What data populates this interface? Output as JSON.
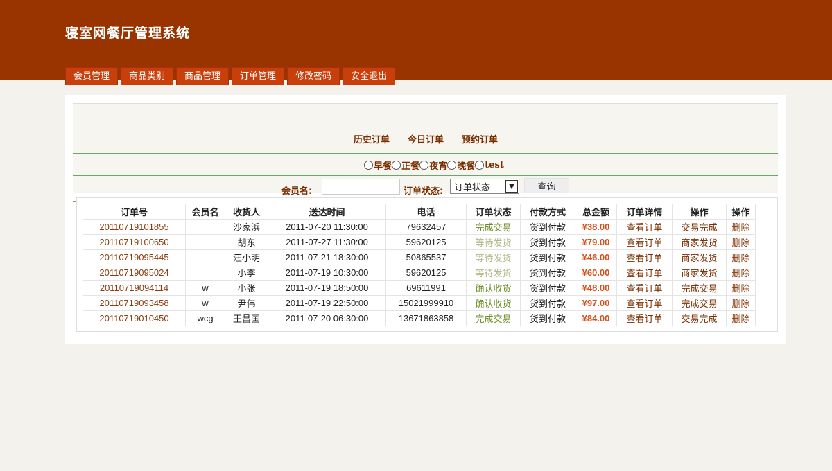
{
  "app": {
    "title": "寝室网餐厅管理系统"
  },
  "nav": {
    "items": [
      {
        "label": "会员管理"
      },
      {
        "label": "商品类别"
      },
      {
        "label": "商品管理"
      },
      {
        "label": "订单管理"
      },
      {
        "label": "修改密码"
      },
      {
        "label": "安全退出"
      }
    ]
  },
  "order_tabs": [
    {
      "label": "历史订单"
    },
    {
      "label": "今日订单"
    },
    {
      "label": "预约订单"
    }
  ],
  "meals": [
    {
      "label": "早餐"
    },
    {
      "label": "正餐"
    },
    {
      "label": "夜宵"
    },
    {
      "label": "晚餐"
    },
    {
      "label": "test"
    }
  ],
  "search": {
    "member_label": "会员名:",
    "member_value": "",
    "status_label": "订单状态:",
    "status_selected": "订单状态",
    "query_label": "查询"
  },
  "colors": {
    "header": "#993300",
    "nav_tab": "#c93f0b",
    "status_done": "#6b8e23",
    "status_waiting": "#b5b88a",
    "amount": "#d4501a"
  },
  "table": {
    "headers": [
      "订单号",
      "会员名",
      "收货人",
      "送达时间",
      "电话",
      "订单状态",
      "付款方式",
      "总金额",
      "订单详情",
      "操作",
      "操作"
    ],
    "rows": [
      {
        "id": "20110719101855",
        "member": "",
        "receiver": "沙家浜",
        "time": "2011-07-20 11:30:00",
        "phone": "79632457",
        "status": "完成交易",
        "status_kind": "done",
        "payment": "货到付款",
        "amount": "¥38.00",
        "detail": "查看订单",
        "action": "交易完成",
        "delete": "删除"
      },
      {
        "id": "20110719100650",
        "member": "",
        "receiver": "胡东",
        "time": "2011-07-27 11:30:00",
        "phone": "59620125",
        "status": "等待发货",
        "status_kind": "waiting",
        "payment": "货到付款",
        "amount": "¥79.00",
        "detail": "查看订单",
        "action": "商家发货",
        "delete": "删除"
      },
      {
        "id": "20110719095445",
        "member": "",
        "receiver": "汪小明",
        "time": "2011-07-21 18:30:00",
        "phone": "50865537",
        "status": "等待发货",
        "status_kind": "waiting",
        "payment": "货到付款",
        "amount": "¥46.00",
        "detail": "查看订单",
        "action": "商家发货",
        "delete": "删除"
      },
      {
        "id": "20110719095024",
        "member": "",
        "receiver": "小李",
        "time": "2011-07-19 10:30:00",
        "phone": "59620125",
        "status": "等待发货",
        "status_kind": "waiting",
        "payment": "货到付款",
        "amount": "¥60.00",
        "detail": "查看订单",
        "action": "商家发货",
        "delete": "删除"
      },
      {
        "id": "20110719094114",
        "member": "w",
        "receiver": "小张",
        "time": "2011-07-19 18:50:00",
        "phone": "69611991",
        "status": "确认收货",
        "status_kind": "done",
        "payment": "货到付款",
        "amount": "¥48.00",
        "detail": "查看订单",
        "action": "完成交易",
        "delete": "删除"
      },
      {
        "id": "20110719093458",
        "member": "w",
        "receiver": "尹伟",
        "time": "2011-07-19 22:50:00",
        "phone": "15021999910",
        "status": "确认收货",
        "status_kind": "done",
        "payment": "货到付款",
        "amount": "¥97.00",
        "detail": "查看订单",
        "action": "完成交易",
        "delete": "删除"
      },
      {
        "id": "20110719010450",
        "member": "wcg",
        "receiver": "王昌国",
        "time": "2011-07-20 06:30:00",
        "phone": "13671863858",
        "status": "完成交易",
        "status_kind": "done",
        "payment": "货到付款",
        "amount": "¥84.00",
        "detail": "查看订单",
        "action": "交易完成",
        "delete": "删除"
      }
    ]
  }
}
